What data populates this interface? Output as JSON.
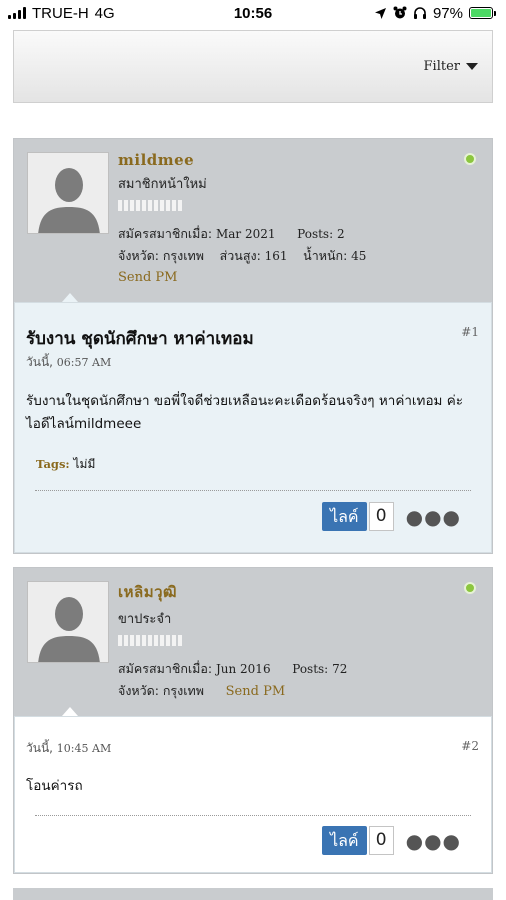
{
  "status_bar": {
    "carrier": "TRUE-H",
    "network": "4G",
    "time": "10:56",
    "battery": "97%"
  },
  "toolbar": {
    "filter_label": "Filter"
  },
  "posts": [
    {
      "username": "mildmee",
      "user_title": "สมาชิกหน้าใหม่",
      "join_label": "สมัครสมาชิกเมื่อ:",
      "join_date": "Mar 2021",
      "posts_label": "Posts:",
      "posts_count": "2",
      "province_label": "จังหวัด:",
      "province": "กรุงเทพ",
      "height_label": "ส่วนสูง:",
      "height": "161",
      "weight_label": "น้ำหนัก:",
      "weight": "45",
      "send_pm": "Send PM",
      "title": "รับงาน ชุดนักศึกษา หาค่าเทอม",
      "date_label": "วันนี้,",
      "time": "06:57 AM",
      "number": "#1",
      "text": "รับงานในชุดนักศึกษา ขอพี่ใจดีช่วยเหลือนะคะเดือดร้อนจริงๆ หาค่าเทอม ค่ะ ไอดีไลน์mildmeee",
      "tags_label": "Tags:",
      "tags_value": "ไม่มี",
      "like_label": "ไลค์",
      "like_count": "0"
    },
    {
      "username": "เหลิมวุฒิ",
      "user_title": "ขาประจำ",
      "join_label": "สมัครสมาชิกเมื่อ:",
      "join_date": "Jun 2016",
      "posts_label": "Posts:",
      "posts_count": "72",
      "province_label": "จังหวัด:",
      "province": "กรุงเทพ",
      "send_pm": "Send PM",
      "date_label": "วันนี้,",
      "time": "10:45 AM",
      "number": "#2",
      "text": "โอนค่ารถ",
      "like_label": "ไลค์",
      "like_count": "0"
    }
  ],
  "colors": {
    "username": "#8a6a1f",
    "like_button": "#3a74b3",
    "online": "#8cc63f",
    "post_header_bg": "#c9cccf",
    "post_body_bg": "#eaf2f6"
  }
}
